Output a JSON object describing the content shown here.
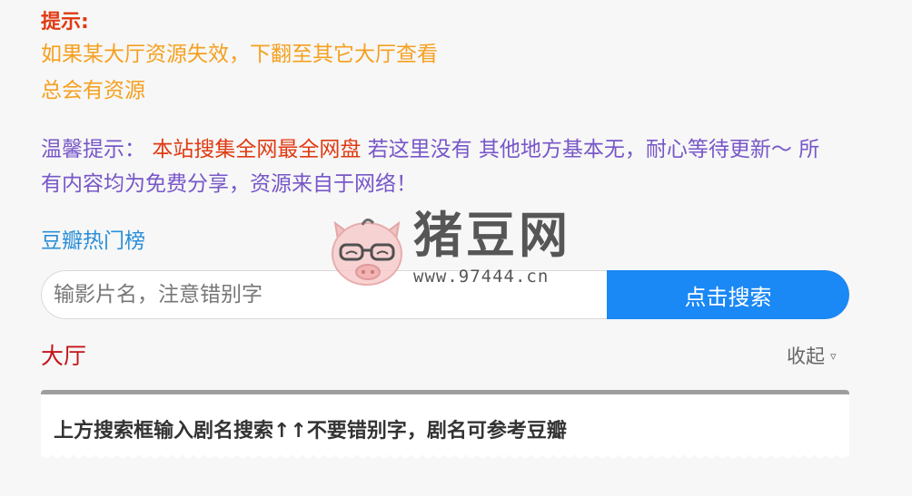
{
  "tip": {
    "title": "提示:",
    "line1": "如果某大厅资源失效，下翻至其它大厅查看",
    "line2": "总会有资源"
  },
  "notice": {
    "prefix": "温馨提示： ",
    "highlight": "本站搜集全网最全网盘",
    "rest": " 若这里没有 其他地方基本无，耐心等待更新～ 所有内容均为免费分享，资源来自于网络！"
  },
  "douban_link": "豆瓣热门榜",
  "logo": {
    "name": "猪豆网",
    "url": "www.97444.cn"
  },
  "search": {
    "placeholder": "输影片名，注意错别字",
    "button": "点击搜索"
  },
  "hall": {
    "title": "大厅",
    "collapse": "收起",
    "collapse_icon": "▿"
  },
  "card": {
    "text": "上方搜索框输入剧名搜索↑↑不要错别字，剧名可参考豆瓣"
  },
  "colors": {
    "accent_blue": "#1a88f5",
    "red": "#e03a12",
    "orange": "#f5a020",
    "purple": "#7757c8",
    "link": "#2a8fd8",
    "hall_red": "#c4141a"
  }
}
